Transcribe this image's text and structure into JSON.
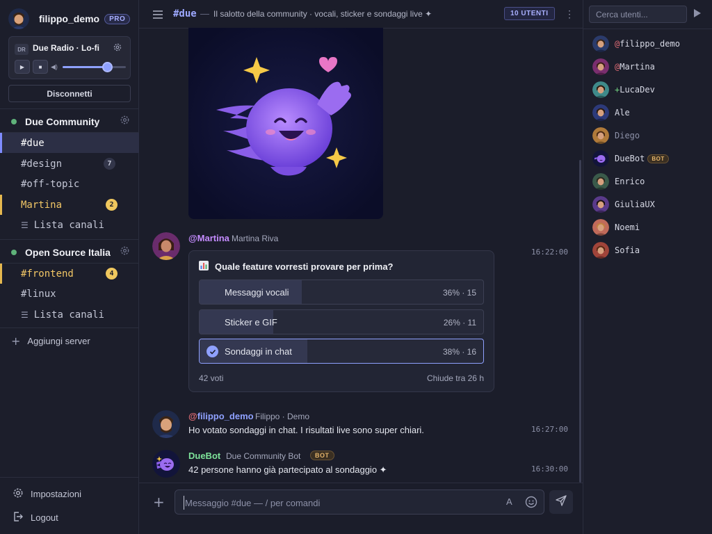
{
  "current_user": {
    "name": "filippo_demo",
    "badge": "PRO"
  },
  "radio": {
    "abbr": "DR",
    "title": "Due Radio · Lo-fi",
    "volume": 0.7,
    "disconnect_label": "Disconnetti"
  },
  "servers": [
    {
      "name": "Due Community",
      "channels": [
        {
          "label": "#due",
          "state": "active"
        },
        {
          "label": "#design",
          "badge": "7",
          "badge_style": "gray"
        },
        {
          "label": "#off-topic"
        },
        {
          "label": "Martina",
          "state": "unread",
          "badge": "2",
          "badge_style": "gold"
        },
        {
          "label": "Lista canali",
          "icon": "list-icon"
        }
      ]
    },
    {
      "name": "Open Source Italia",
      "channels": [
        {
          "label": "#frontend",
          "state": "unread",
          "badge": "4",
          "badge_style": "gold"
        },
        {
          "label": "#linux"
        },
        {
          "label": "Lista canali",
          "icon": "list-icon"
        }
      ]
    }
  ],
  "add_server_label": "Aggiungi server",
  "footer": {
    "settings_label": "Impostazioni",
    "logout_label": "Logout"
  },
  "channel_header": {
    "name": "#due",
    "separator": "—",
    "description": "Il salotto della community · vocali, sticker e sondaggi live ✦",
    "users_badge": "10 UTENTI"
  },
  "messages": [
    {
      "user": "@Martina",
      "real_name": "Martina Riva",
      "time": "16:22:00",
      "poll": {
        "question": "Quale feature vorresti provare per prima?",
        "options": [
          {
            "label": "Messaggi vocali",
            "stat": "36% · 15",
            "percent": 36,
            "selected": false
          },
          {
            "label": "Sticker e GIF",
            "stat": "26% · 11",
            "percent": 26,
            "selected": false
          },
          {
            "label": "Sondaggi in chat",
            "stat": "38% · 16",
            "percent": 38,
            "selected": true
          }
        ],
        "votes": "42 voti",
        "closes": "Chiude tra 26 h"
      }
    },
    {
      "user": "@filippo_demo",
      "real_name": "Filippo · Demo",
      "time": "16:27:00",
      "text": "Ho votato sondaggi in chat. I risultati live sono super chiari."
    },
    {
      "user": "DueBot",
      "real_name": "Due Community Bot",
      "badge": "BOT",
      "time": "16:30:00",
      "text": "42 persone hanno già partecipato al sondaggio ✦"
    }
  ],
  "composer": {
    "placeholder": "Messaggio #due — / per comandi",
    "format_label": "A"
  },
  "user_search": {
    "placeholder": "Cerca utenti..."
  },
  "members": [
    {
      "name": "@filippo_demo",
      "prefix_color": "#e06c75"
    },
    {
      "name": "@Martina",
      "prefix_color": "#e06c75"
    },
    {
      "name": "+LucaDev",
      "prefix_color": "#6fcf7f"
    },
    {
      "name": "Ale"
    },
    {
      "name": "Diego",
      "away": true
    },
    {
      "name": "DueBot",
      "badge": "BOT"
    },
    {
      "name": "Enrico"
    },
    {
      "name": "GiuliaUX"
    },
    {
      "name": "Noemi"
    },
    {
      "name": "Sofia"
    }
  ],
  "colors": {
    "accent": "#8fa1ff",
    "unread": "#efc75e",
    "online": "#5fb27a",
    "bot_name": "#7ee39a",
    "martina_name": "#c58cff",
    "filippo_name": "#8fa1ff"
  }
}
